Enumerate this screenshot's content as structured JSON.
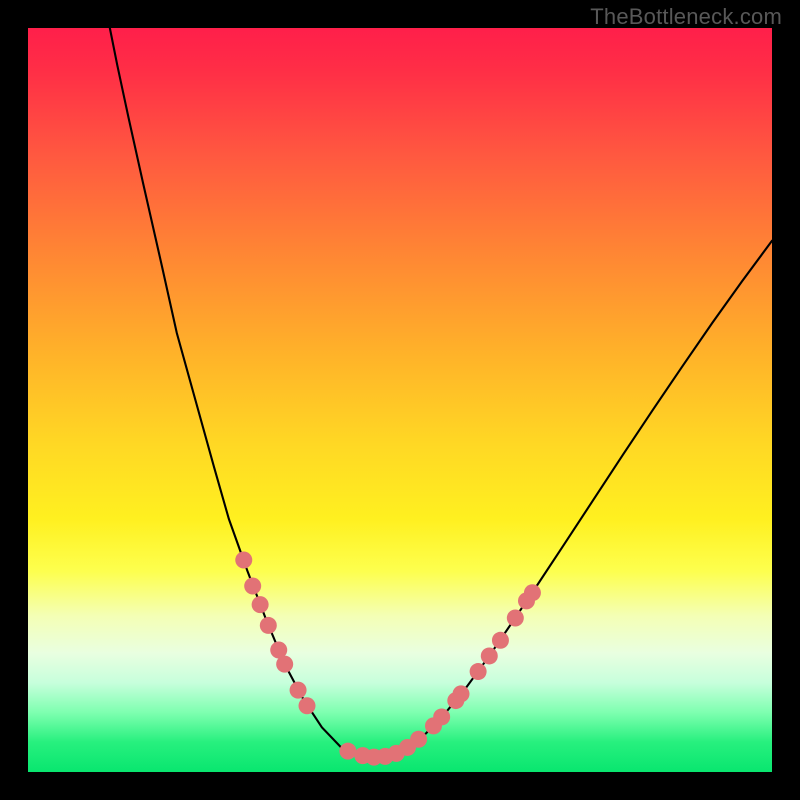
{
  "watermark": "TheBottleneck.com",
  "colors": {
    "frame": "#000000",
    "curve": "#000000",
    "dot": "#e27276",
    "gradient_top": "#ff1f4a",
    "gradient_bottom": "#09e66f"
  },
  "chart_data": {
    "type": "line",
    "title": "",
    "xlabel": "",
    "ylabel": "",
    "xlim": [
      0,
      100
    ],
    "ylim": [
      0,
      100
    ],
    "curve": {
      "description": "Bottleneck curve: steep left arm descending from top-left, flat minimum near x≈43–50, right arm rising to upper-right",
      "points": [
        {
          "x": 11.0,
          "y": 100.0
        },
        {
          "x": 12.0,
          "y": 95.0
        },
        {
          "x": 13.5,
          "y": 88.0
        },
        {
          "x": 15.5,
          "y": 79.0
        },
        {
          "x": 18.0,
          "y": 68.0
        },
        {
          "x": 20.0,
          "y": 59.0
        },
        {
          "x": 22.5,
          "y": 50.0
        },
        {
          "x": 25.0,
          "y": 41.0
        },
        {
          "x": 27.0,
          "y": 34.0
        },
        {
          "x": 29.5,
          "y": 27.0
        },
        {
          "x": 32.0,
          "y": 20.5
        },
        {
          "x": 34.5,
          "y": 14.5
        },
        {
          "x": 37.0,
          "y": 9.8
        },
        {
          "x": 39.5,
          "y": 6.0
        },
        {
          "x": 42.0,
          "y": 3.4
        },
        {
          "x": 44.5,
          "y": 2.2
        },
        {
          "x": 47.0,
          "y": 2.0
        },
        {
          "x": 49.0,
          "y": 2.3
        },
        {
          "x": 51.0,
          "y": 3.3
        },
        {
          "x": 53.5,
          "y": 5.2
        },
        {
          "x": 56.0,
          "y": 7.8
        },
        {
          "x": 59.0,
          "y": 11.5
        },
        {
          "x": 62.0,
          "y": 15.6
        },
        {
          "x": 65.0,
          "y": 20.0
        },
        {
          "x": 68.5,
          "y": 25.2
        },
        {
          "x": 72.0,
          "y": 30.5
        },
        {
          "x": 76.0,
          "y": 36.6
        },
        {
          "x": 80.0,
          "y": 42.7
        },
        {
          "x": 84.0,
          "y": 48.7
        },
        {
          "x": 88.0,
          "y": 54.6
        },
        {
          "x": 92.0,
          "y": 60.4
        },
        {
          "x": 96.0,
          "y": 66.0
        },
        {
          "x": 100.0,
          "y": 71.4
        }
      ]
    },
    "series": [
      {
        "name": "left-arm-markers",
        "values": [
          {
            "x": 29.0,
            "y": 28.5
          },
          {
            "x": 30.2,
            "y": 25.0
          },
          {
            "x": 31.2,
            "y": 22.5
          },
          {
            "x": 32.3,
            "y": 19.7
          },
          {
            "x": 33.7,
            "y": 16.4
          },
          {
            "x": 34.5,
            "y": 14.5
          },
          {
            "x": 36.3,
            "y": 11.0
          },
          {
            "x": 37.5,
            "y": 8.9
          }
        ]
      },
      {
        "name": "valley-markers",
        "values": [
          {
            "x": 43.0,
            "y": 2.8
          },
          {
            "x": 45.0,
            "y": 2.2
          },
          {
            "x": 46.5,
            "y": 2.0
          },
          {
            "x": 48.0,
            "y": 2.1
          },
          {
            "x": 49.5,
            "y": 2.5
          },
          {
            "x": 51.0,
            "y": 3.3
          },
          {
            "x": 52.5,
            "y": 4.4
          }
        ]
      },
      {
        "name": "right-arm-markers",
        "values": [
          {
            "x": 54.5,
            "y": 6.2
          },
          {
            "x": 55.6,
            "y": 7.4
          },
          {
            "x": 57.5,
            "y": 9.6
          },
          {
            "x": 58.2,
            "y": 10.5
          },
          {
            "x": 60.5,
            "y": 13.5
          },
          {
            "x": 62.0,
            "y": 15.6
          },
          {
            "x": 63.5,
            "y": 17.7
          },
          {
            "x": 65.5,
            "y": 20.7
          },
          {
            "x": 67.0,
            "y": 23.0
          },
          {
            "x": 67.8,
            "y": 24.1
          }
        ]
      }
    ]
  }
}
